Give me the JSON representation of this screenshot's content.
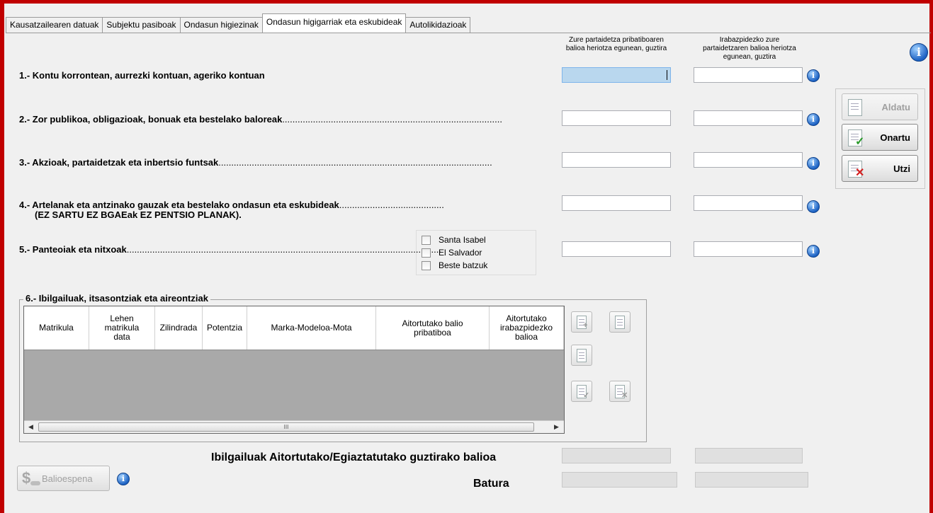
{
  "tabs": [
    {
      "label": "Kausatzailearen datuak"
    },
    {
      "label": "Subjektu pasiboak"
    },
    {
      "label": "Ondasun higiezinak"
    },
    {
      "label": "Ondasun higigarriak eta eskubideak"
    },
    {
      "label": "Autolikidazioak"
    }
  ],
  "active_tab_index": 3,
  "column_headers": {
    "private_line1": "Zure partaidetza pribatiboaren",
    "private_line2": "balioa heriotza egunean, guztira",
    "gain_line1": "Irabazpidezko zure",
    "gain_line2": "partaidetzaren balioa heriotza",
    "gain_line3": "egunean, guztira"
  },
  "rows": {
    "r1": {
      "label": "1.- Kontu korrontean, aurrezki kontuan, ageriko kontuan"
    },
    "r2": {
      "label": "2.- Zor publikoa, obligazioak, bonuak eta bestelako baloreak",
      "dots": "......................................................................................"
    },
    "r3": {
      "label": "3.- Akzioak, partaidetzak eta inbertsio funtsak",
      "dots": "..........................................................................................................."
    },
    "r4": {
      "label": "4.- Artelanak eta antzinako gauzak eta bestelako ondasun eta eskubideak",
      "dots": ".........................................",
      "sublabel": "(EZ SARTU EZ BGAEak EZ PENTSIO PLANAK)."
    },
    "r5": {
      "label": "5.- Panteoiak eta nitxoak",
      "dots": "..........................................................................................................................."
    }
  },
  "cemetery_options": [
    {
      "label": "Santa Isabel",
      "checked": false
    },
    {
      "label": "El Salvador",
      "checked": false
    },
    {
      "label": "Beste batzuk",
      "checked": false
    }
  ],
  "actions": {
    "aldatu": "Aldatu",
    "onartu": "Onartu",
    "utzi": "Utzi"
  },
  "vehicles": {
    "group_label": "6.- Ibilgailuak, itsasontziak eta aireontziak",
    "columns": [
      {
        "label": "Matrikula"
      },
      {
        "label": "Lehen matrikula data"
      },
      {
        "label": "Zilindrada"
      },
      {
        "label": "Potentzia"
      },
      {
        "label": "Marka-Modeloa-Mota"
      },
      {
        "label": "Aitortutako balio pribatiboa"
      },
      {
        "label": "Aitortutako irabazpidezko balioa"
      }
    ],
    "scroll_grip": "III"
  },
  "totals": {
    "vehicles_total_label": "Ibilgailuak Aitortutako/Egiaztatutako guztirako balioa",
    "sum_label": "Batura"
  },
  "balioespena_label": "Balioespena",
  "info_glyph": "i",
  "colors": {
    "frame": "#c00000",
    "focus": "#b9d7ee",
    "info": "#1e63c4"
  }
}
